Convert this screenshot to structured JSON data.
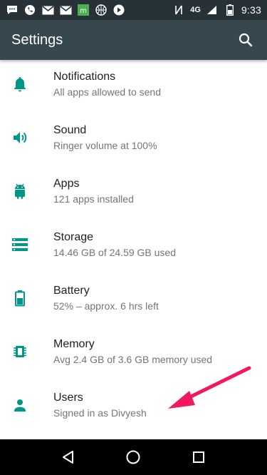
{
  "statusbar": {
    "time": "9:33",
    "network": "4G",
    "icons": [
      "chat-icon",
      "whatsapp-icon",
      "gmail-icon",
      "mail-icon",
      "app-icon",
      "basketball-icon",
      "play-icon",
      "signal-icon",
      "battery-icon"
    ]
  },
  "appbar": {
    "title": "Settings"
  },
  "items": [
    {
      "title": "Notifications",
      "subtitle": "All apps allowed to send",
      "icon": "bell-icon"
    },
    {
      "title": "Sound",
      "subtitle": "Ringer volume at 100%",
      "icon": "speaker-icon"
    },
    {
      "title": "Apps",
      "subtitle": "121 apps installed",
      "icon": "android-icon"
    },
    {
      "title": "Storage",
      "subtitle": "14.46 GB of 24.59 GB used",
      "icon": "storage-icon"
    },
    {
      "title": "Battery",
      "subtitle": "52% – approx. 6 hrs left",
      "icon": "battery-icon"
    },
    {
      "title": "Memory",
      "subtitle": "Avg 2.4 GB of 3.6 GB memory used",
      "icon": "memory-icon"
    },
    {
      "title": "Users",
      "subtitle": "Signed in as Divyesh",
      "icon": "person-icon"
    }
  ],
  "colors": {
    "accent": "#009688",
    "appbar": "#37474f",
    "statusbar": "#263238",
    "annotation_arrow": "#f2185f"
  }
}
